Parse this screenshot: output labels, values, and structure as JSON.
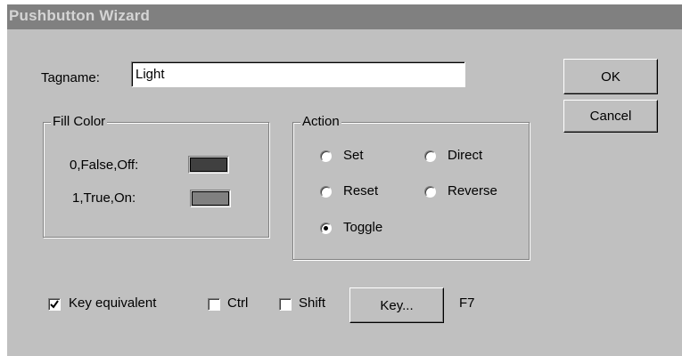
{
  "window": {
    "title": "Pushbutton Wizard"
  },
  "tagname": {
    "label": "Tagname:",
    "value": "Light"
  },
  "buttons": {
    "ok": "OK",
    "cancel": "Cancel",
    "key": "Key..."
  },
  "fill_color": {
    "legend": "Fill Color",
    "off_label": "0,False,Off:",
    "on_label": "1,True,On:",
    "off_color": "#404040",
    "on_color": "#808080"
  },
  "action": {
    "legend": "Action",
    "options": [
      {
        "label": "Set",
        "selected": false
      },
      {
        "label": "Direct",
        "selected": false
      },
      {
        "label": "Reset",
        "selected": false
      },
      {
        "label": "Reverse",
        "selected": false
      },
      {
        "label": "Toggle",
        "selected": true
      }
    ]
  },
  "key_row": {
    "key_equivalent_label": "Key equivalent",
    "key_equivalent_checked": true,
    "ctrl_label": "Ctrl",
    "ctrl_checked": false,
    "shift_label": "Shift",
    "shift_checked": false,
    "key_value": "F7"
  },
  "colors": {
    "dialog_bg": "#c0c0c0",
    "titlebar_bg": "#808080",
    "title_text": "#d4d4d4"
  }
}
